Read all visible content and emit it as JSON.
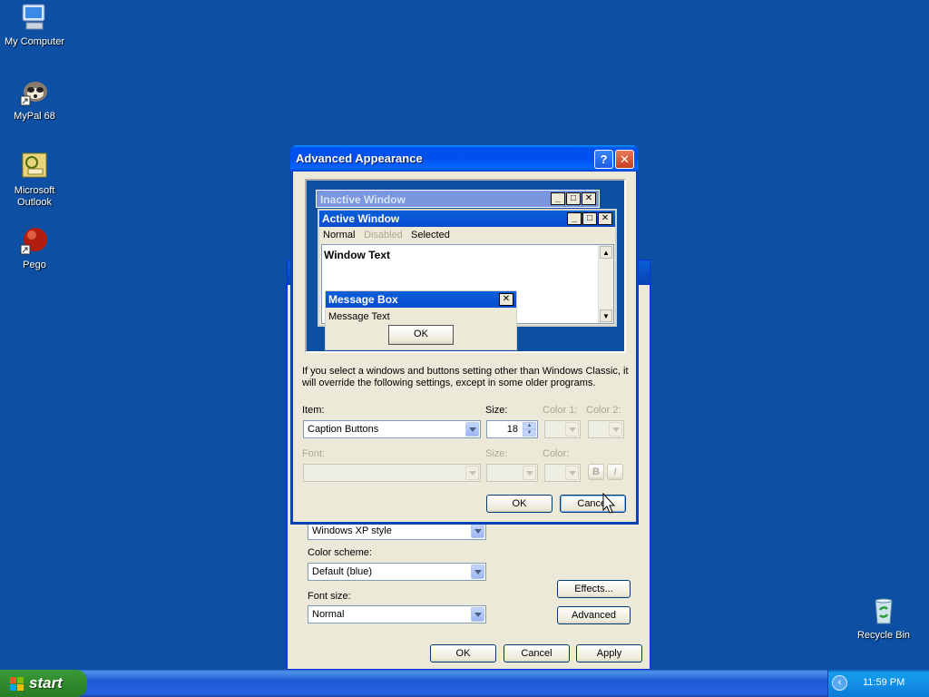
{
  "desktop": {
    "icons": [
      {
        "label": "My Computer",
        "icon": "computer-icon"
      },
      {
        "label": "MyPal 68",
        "icon": "raccoon-icon"
      },
      {
        "label": "Microsoft Outlook",
        "icon": "outlook-icon"
      },
      {
        "label": "Pego",
        "icon": "red-ball-icon"
      },
      {
        "label": "Recycle Bin",
        "icon": "recycle-bin-icon"
      }
    ]
  },
  "back_dialog": {
    "style_value": "Windows XP style",
    "color_scheme_label": "Color scheme:",
    "color_scheme_value": "Default (blue)",
    "font_size_label": "Font size:",
    "font_size_value": "Normal",
    "effects_label": "Effects...",
    "advanced_label": "Advanced",
    "ok_label": "OK",
    "cancel_label": "Cancel",
    "apply_label": "Apply"
  },
  "adv_dialog": {
    "title": "Advanced Appearance",
    "help_glyph": "?",
    "close_glyph": "✕",
    "preview": {
      "inactive_title": "Inactive Window",
      "active_title": "Active Window",
      "menu_normal": "Normal",
      "menu_disabled": "Disabled",
      "menu_selected": "Selected",
      "window_text": "Window Text",
      "msgbox_title": "Message Box",
      "msgbox_text": "Message Text",
      "msgbox_ok": "OK"
    },
    "info_text": "If you select a windows and buttons setting other than Windows Classic, it will override the following settings, except in some older programs.",
    "item_label": "Item:",
    "item_value": "Caption Buttons",
    "size_label": "Size:",
    "size_value": "18",
    "color1_label": "Color 1:",
    "color2_label": "Color 2:",
    "font_label": "Font:",
    "font_size_label": "Size:",
    "font_color_label": "Color:",
    "bold_label": "B",
    "italic_label": "I",
    "ok_label": "OK",
    "cancel_label": "Cancel"
  },
  "taskbar": {
    "start_label": "start",
    "clock": "11:59 PM"
  }
}
